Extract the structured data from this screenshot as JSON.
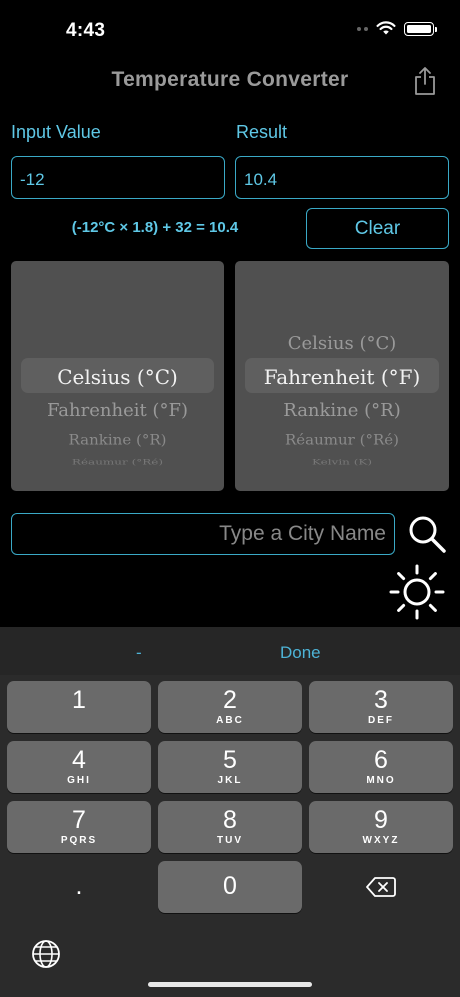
{
  "status_bar": {
    "time": "4:43"
  },
  "nav": {
    "title": "Temperature Converter"
  },
  "input": {
    "label": "Input Value",
    "value": "-12"
  },
  "result": {
    "label": "Result",
    "value": "10.4"
  },
  "formula": "(-12°C × 1.8) + 32 = 10.4",
  "clear_label": "Clear",
  "from_picker": {
    "selected": "Celsius (°C)",
    "options": [
      "Celsius (°C)",
      "Fahrenheit (°F)",
      "Rankine (°R)",
      "Réaumur (°Ré)"
    ]
  },
  "to_picker": {
    "selected": "Fahrenheit (°F)",
    "options": [
      "Celsius (°C)",
      "Fahrenheit (°F)",
      "Rankine (°R)",
      "Réaumur (°Ré)",
      "Kelvin (K)"
    ]
  },
  "city_search": {
    "placeholder": "Type a City Name"
  },
  "keyboard": {
    "toolbar": {
      "minus": "-",
      "done": "Done"
    },
    "keys": [
      {
        "digit": "1",
        "letters": ""
      },
      {
        "digit": "2",
        "letters": "ABC"
      },
      {
        "digit": "3",
        "letters": "DEF"
      },
      {
        "digit": "4",
        "letters": "GHI"
      },
      {
        "digit": "5",
        "letters": "JKL"
      },
      {
        "digit": "6",
        "letters": "MNO"
      },
      {
        "digit": "7",
        "letters": "PQRS"
      },
      {
        "digit": "8",
        "letters": "TUV"
      },
      {
        "digit": "9",
        "letters": "WXYZ"
      },
      {
        "digit": ".",
        "letters": ""
      },
      {
        "digit": "0",
        "letters": ""
      }
    ]
  },
  "icons": {
    "share": "share-icon",
    "search": "search-icon",
    "theme": "sun-icon",
    "delete": "delete-backspace-icon",
    "globe": "globe-icon"
  },
  "colors": {
    "accent": "#5fc8e6",
    "background": "#000000",
    "picker": "#505050"
  }
}
